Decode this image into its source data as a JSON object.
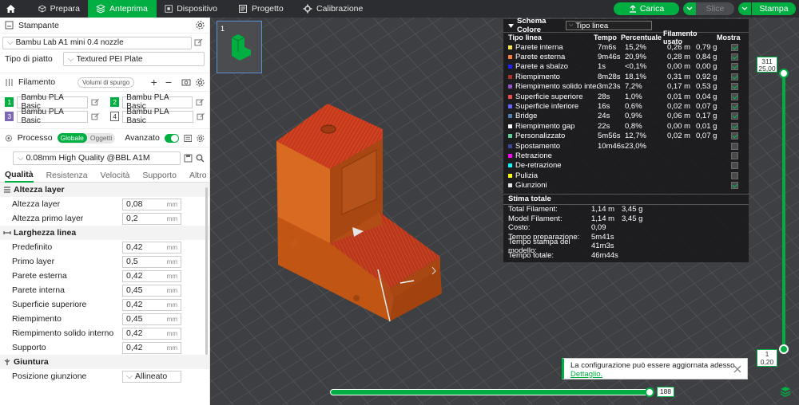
{
  "topbar": {
    "tabs": [
      {
        "label": "Prepara"
      },
      {
        "label": "Anteprima"
      },
      {
        "label": "Dispositivo"
      },
      {
        "label": "Progetto"
      },
      {
        "label": "Calibrazione"
      }
    ],
    "carica": "Carica",
    "slice": "Slice",
    "stampa": "Stampa"
  },
  "printer": {
    "header": "Stampante",
    "name": "Bambu Lab A1 mini 0.4 nozzle",
    "plate_label": "Tipo di piatto",
    "plate_value": "Textured PEI Plate"
  },
  "filament": {
    "header": "Filamento",
    "purge_label": "Volumi di spurgo",
    "items": [
      {
        "num": "1",
        "name": "Bambu PLA Basic",
        "color": "#00ae42"
      },
      {
        "num": "2",
        "name": "Bambu PLA Basic",
        "color": "#00ae42"
      },
      {
        "num": "3",
        "name": "Bambu PLA Basic",
        "color": "#7b69b4"
      },
      {
        "num": "4",
        "name": "Bambu PLA Basic",
        "color": "#ffffff"
      }
    ]
  },
  "process": {
    "header": "Processo",
    "toggle_global": "Globale",
    "toggle_objects": "Oggetti",
    "advanced_label": "Avanzato",
    "preset": "0.08mm High Quality @BBL A1M",
    "tabs": [
      "Qualità",
      "Resistenza",
      "Velocità",
      "Supporto",
      "Altro"
    ],
    "groups": [
      {
        "title": "Altezza layer",
        "params": [
          {
            "label": "Altezza layer",
            "value": "0,08",
            "unit": "mm"
          },
          {
            "label": "Altezza primo layer",
            "value": "0,2",
            "unit": "mm"
          }
        ]
      },
      {
        "title": "Larghezza linea",
        "params": [
          {
            "label": "Predefinito",
            "value": "0,42",
            "unit": "mm"
          },
          {
            "label": "Primo layer",
            "value": "0,5",
            "unit": "mm"
          },
          {
            "label": "Parete esterna",
            "value": "0,42",
            "unit": "mm"
          },
          {
            "label": "Parete interna",
            "value": "0,45",
            "unit": "mm"
          },
          {
            "label": "Superficie superiore",
            "value": "0,42",
            "unit": "mm"
          },
          {
            "label": "Riempimento",
            "value": "0,45",
            "unit": "mm"
          },
          {
            "label": "Riempimento solido interno",
            "value": "0,42",
            "unit": "mm"
          },
          {
            "label": "Supporto",
            "value": "0,42",
            "unit": "mm"
          }
        ]
      },
      {
        "title": "Giuntura",
        "params": [
          {
            "label": "Posizione giunzione",
            "value": "Allineato",
            "unit": ""
          }
        ]
      }
    ]
  },
  "viewport": {
    "plate_number": "1",
    "layer_top": "311",
    "layer_top_height": "25,00",
    "layer_bottom": "1",
    "layer_bottom_height": "0,20",
    "horizontal_value": "188"
  },
  "legend": {
    "title": "Schema Colore",
    "mode": "Tipo linea",
    "headers": {
      "type": "Tipo linea",
      "time": "Tempo",
      "pct": "Percentuale",
      "fil": "Filamento usato",
      "show": "Mostra"
    },
    "rows": [
      {
        "name": "Parete interna",
        "color": "#ffe64b",
        "time": "7m6s",
        "pct": "15,2%",
        "len": "0,26 m",
        "g": "0,79 g",
        "show": true
      },
      {
        "name": "Parete esterna",
        "color": "#ff7d38",
        "time": "9m46s",
        "pct": "20,9%",
        "len": "0,28 m",
        "g": "0,84 g",
        "show": true
      },
      {
        "name": "Parete a sbalzo",
        "color": "#1f1fff",
        "time": "1s",
        "pct": "<0,1%",
        "len": "0,00 m",
        "g": "0,00 g",
        "show": true
      },
      {
        "name": "Riempimento",
        "color": "#b03029",
        "time": "8m28s",
        "pct": "18,1%",
        "len": "0,31 m",
        "g": "0,92 g",
        "show": true
      },
      {
        "name": "Riempimento solido interno",
        "color": "#9654cc",
        "time": "3m23s",
        "pct": "7,2%",
        "len": "0,17 m",
        "g": "0,53 g",
        "show": true
      },
      {
        "name": "Superficie superiore",
        "color": "#f04c4c",
        "time": "28s",
        "pct": "1,0%",
        "len": "0,01 m",
        "g": "0,04 g",
        "show": true
      },
      {
        "name": "Superficie inferiore",
        "color": "#6666ff",
        "time": "16s",
        "pct": "0,6%",
        "len": "0,02 m",
        "g": "0,07 g",
        "show": true
      },
      {
        "name": "Bridge",
        "color": "#4d80ba",
        "time": "24s",
        "pct": "0,9%",
        "len": "0,06 m",
        "g": "0,17 g",
        "show": true
      },
      {
        "name": "Riempimento gap",
        "color": "#ffffff",
        "time": "22s",
        "pct": "0,8%",
        "len": "0,00 m",
        "g": "0,01 g",
        "show": true
      },
      {
        "name": "Personalizzato",
        "color": "#5ed194",
        "time": "5m56s",
        "pct": "12,7%",
        "len": "0,02 m",
        "g": "0,07 g",
        "show": true
      },
      {
        "name": "Spostamento",
        "color": "#38489a",
        "time": "10m46s",
        "pct": "23,0%",
        "len": "",
        "g": "",
        "show": false
      },
      {
        "name": "Retrazione",
        "color": "#ff00ff",
        "time": "",
        "pct": "",
        "len": "",
        "g": "",
        "show": false
      },
      {
        "name": "De-retrazione",
        "color": "#00ffff",
        "time": "",
        "pct": "",
        "len": "",
        "g": "",
        "show": false
      },
      {
        "name": "Pulizia",
        "color": "#ffff00",
        "time": "",
        "pct": "",
        "len": "",
        "g": "",
        "show": false
      },
      {
        "name": "Giunzioni",
        "color": "#e6e6e6",
        "time": "",
        "pct": "",
        "len": "",
        "g": "",
        "show": true
      }
    ],
    "estimate_title": "Stima totale",
    "estimates": [
      {
        "label": "Total Filament:",
        "v1": "1,14 m",
        "v2": "3,45 g"
      },
      {
        "label": "Model Filament:",
        "v1": "1,14 m",
        "v2": "3,45 g"
      },
      {
        "label": "Costo:",
        "v1": "0,09",
        "v2": ""
      },
      {
        "label": "Tempo preparazione:",
        "v1": "5m41s",
        "v2": ""
      },
      {
        "label": "Tempo stampa del modello:",
        "v1": "41m3s",
        "v2": ""
      },
      {
        "label": "Tempo totale:",
        "v1": "46m44s",
        "v2": ""
      }
    ]
  },
  "notification": {
    "text": "La configurazione può essere aggiornata adesso.",
    "link": "Dettaglio."
  }
}
